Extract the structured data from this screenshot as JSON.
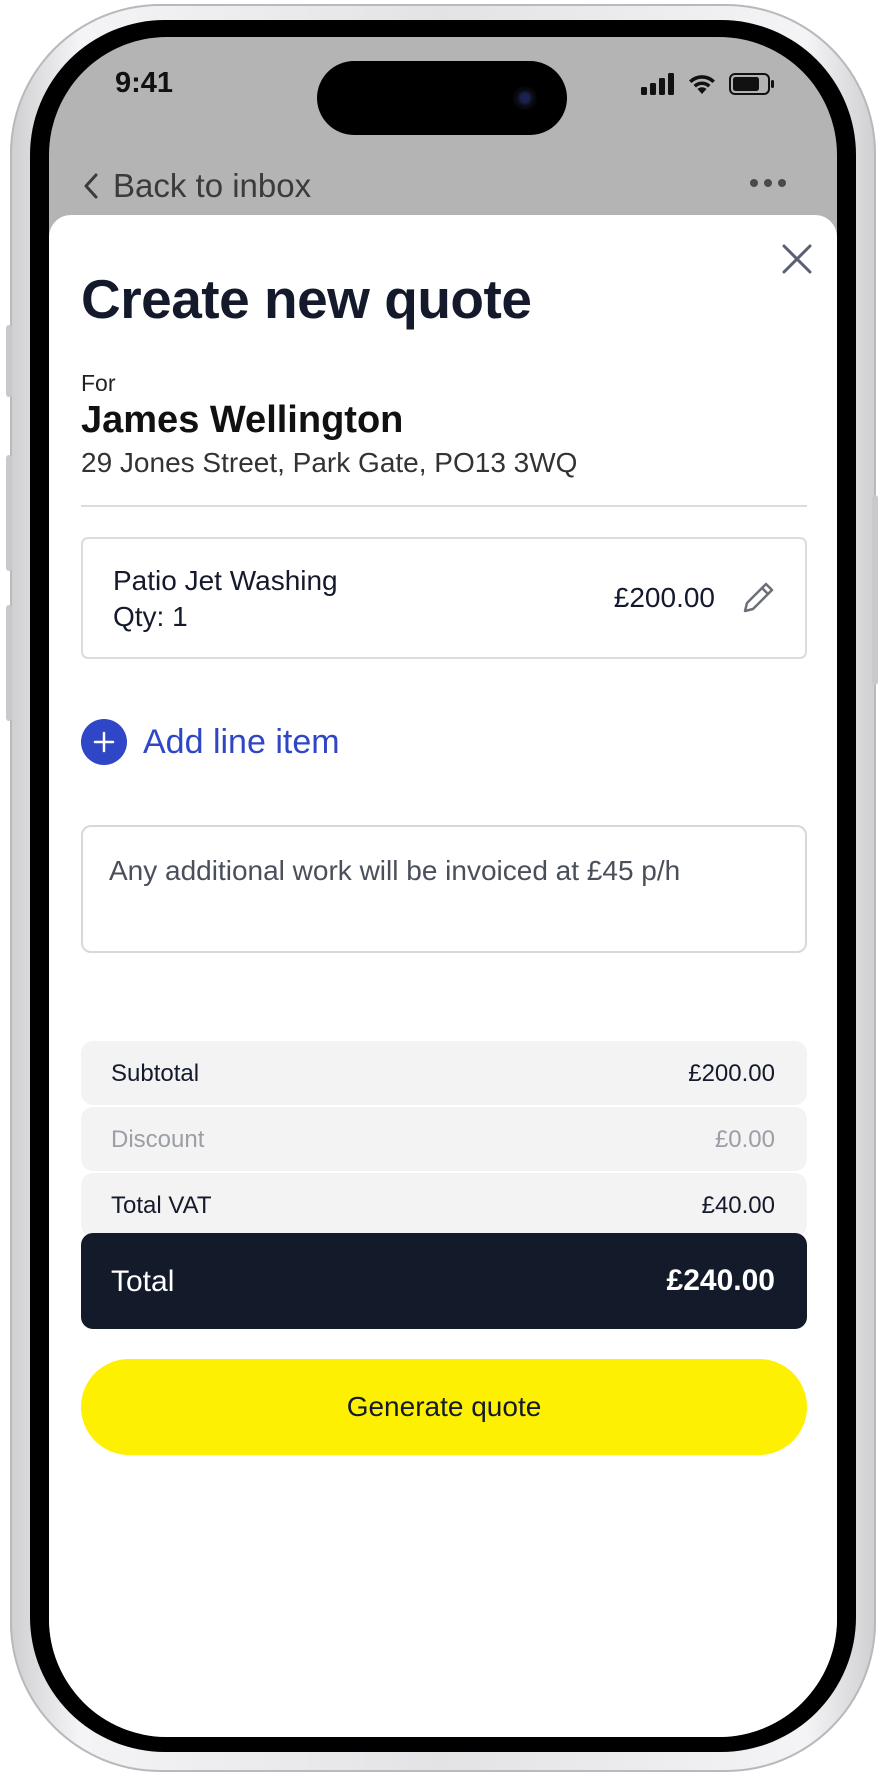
{
  "status_bar": {
    "time": "9:41"
  },
  "nav": {
    "back_label": "Back to inbox",
    "back_icon": "chevron-left-icon",
    "more_icon": "more-horizontal-icon"
  },
  "sheet": {
    "title": "Create new quote",
    "close_icon": "close-icon"
  },
  "customer": {
    "for_label": "For",
    "name": "James Wellington",
    "address": "29 Jones Street, Park Gate, PO13 3WQ"
  },
  "line_items": [
    {
      "name": "Patio Jet Washing",
      "qty_label": "Qty: 1",
      "price": "£200.00",
      "edit_icon": "pencil-icon"
    }
  ],
  "add_line_item": {
    "label": "Add line item",
    "icon": "plus-icon"
  },
  "notes": {
    "value": "Any additional work will be invoiced at £45 p/h"
  },
  "summary": {
    "subtotal": {
      "label": "Subtotal",
      "value": "£200.00"
    },
    "discount": {
      "label": "Discount",
      "value": "£0.00"
    },
    "vat": {
      "label": "Total VAT",
      "value": "£40.00"
    },
    "total": {
      "label": "Total",
      "value": "£240.00"
    }
  },
  "cta": {
    "label": "Generate quote"
  },
  "colors": {
    "accent_blue": "#2f46c6",
    "cta_yellow": "#fdf000",
    "total_bg": "#131a29",
    "title_text": "#141a2b"
  }
}
